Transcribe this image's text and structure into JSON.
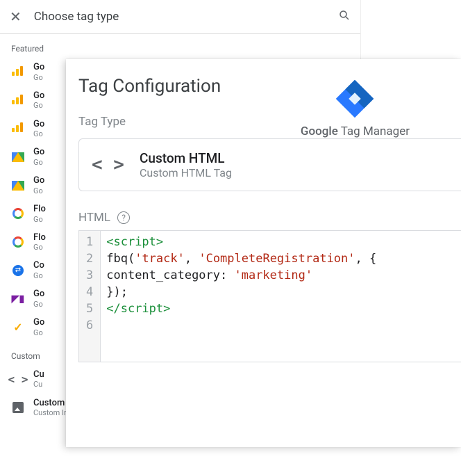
{
  "panel": {
    "title": "Choose tag type",
    "featured_label": "Featured",
    "custom_label": "Custom",
    "items_featured": [
      {
        "t1": "Go",
        "t2": "Go",
        "icon": "bars"
      },
      {
        "t1": "Go",
        "t2": "Go",
        "icon": "bars"
      },
      {
        "t1": "Go",
        "t2": "Go",
        "icon": "bars"
      },
      {
        "t1": "Go",
        "t2": "Go",
        "icon": "tri"
      },
      {
        "t1": "Go",
        "t2": "Go",
        "icon": "tri"
      },
      {
        "t1": "Flo",
        "t2": "Go",
        "icon": "circle"
      },
      {
        "t1": "Flo",
        "t2": "Go",
        "icon": "circle"
      },
      {
        "t1": "Co",
        "t2": "Go",
        "icon": "blue"
      },
      {
        "t1": "Go",
        "t2": "Go",
        "icon": "opt"
      },
      {
        "t1": "Go",
        "t2": "Go",
        "icon": "check"
      }
    ],
    "items_custom": [
      {
        "t1": "Cu",
        "t2": "Cu",
        "icon": "angles"
      },
      {
        "t1": "Custom Image",
        "t2": "Custom Image Tag",
        "icon": "img"
      }
    ]
  },
  "card": {
    "heading": "Tag Configuration",
    "brand_text_bold": "Google",
    "brand_text_rest": " Tag Manager",
    "tag_type_label": "Tag Type",
    "tag_type_name": "Custom HTML",
    "tag_type_desc": "Custom HTML Tag",
    "html_label": "HTML",
    "code_lines": [
      {
        "n": "1",
        "html": "<span class='tok-tag'>&lt;script&gt;</span>"
      },
      {
        "n": "2",
        "html": "fbq(<span class='tok-str'>'track'</span>, <span class='tok-str'>'CompleteRegistration'</span>, {"
      },
      {
        "n": "3",
        "html": "content_category: <span class='tok-str'>'marketing'</span>"
      },
      {
        "n": "4",
        "html": "});"
      },
      {
        "n": "5",
        "html": "<span class='tok-tag'>&lt;/script&gt;</span>"
      },
      {
        "n": "6",
        "html": ""
      }
    ]
  }
}
